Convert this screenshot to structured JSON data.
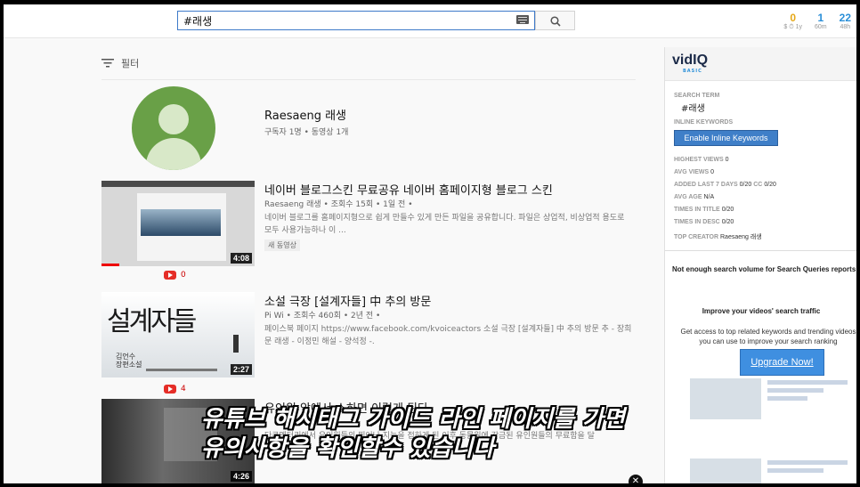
{
  "search": {
    "value": "#래생"
  },
  "stats": [
    {
      "value": "0",
      "label": "$ ⏱ 1y",
      "color": "#e6a817"
    },
    {
      "value": "1",
      "label": "60m",
      "color": "#2a8fd8"
    },
    {
      "value": "22",
      "label": "48h",
      "color": "#2a8fd8"
    }
  ],
  "filter": {
    "label": "필터"
  },
  "channel": {
    "name": "Raesaeng 래생",
    "meta": "구독자 1명 • 동영상 1개"
  },
  "videos": [
    {
      "title": "네이버 블로그스킨 무료공유 네이버 홈페이지형 블로그 스킨",
      "meta": "Raesaeng 래생 • 조회수 15회 • 1일 전 •",
      "desc": "네이버 블로그를 홈페이지형으로 쉽게 만들수 있게 만든 파일을 공유합니다. 파일은 상업적, 비상업적 용도로 모두 사용가능하나 이 ...",
      "badge": "새 동영상",
      "duration": "4:08",
      "yt_count": "0"
    },
    {
      "title": "소설 극장 [설계자들] 中 추의 방문",
      "meta": "Pi Wi • 조회수 460회 • 2년 전 •",
      "desc": "페이스북 페이지 https://www.facebook.com/kvoiceactors 소설 극장 [설계자들] 中 추의 방문 추 - 장희문 래생 - 이정민 해설 - 양석정 -.",
      "thumb_text": "설계자들",
      "thumb_sub": "김언수 장편소설",
      "duration": "2:27",
      "yt_count": "4"
    },
    {
      "title": "유인원 앞에서 쇼하면 이렇게 된다",
      "meta": "",
      "desc": "다큐멘터리에서 유인원들의 뛰어난 지능을 접하게 된 이후 동물원에 감금된 유인원들의 무료함을 달",
      "duration": "4:26"
    }
  ],
  "vidiq": {
    "logo": "vidIQ",
    "tier": "BASIC",
    "search_term_label": "SEARCH TERM",
    "search_term": "#래생",
    "inline_label": "INLINE KEYWORDS",
    "enable_button": "Enable Inline Keywords",
    "stats": [
      {
        "label": "HIGHEST VIEWS",
        "value": "0"
      },
      {
        "label": "AVG VIEWS",
        "value": "0"
      },
      {
        "label": "ADDED LAST 7 DAYS",
        "value": "0/20",
        "extra_label": "CC",
        "extra_value": "0/20"
      },
      {
        "label": "AVG AGE",
        "value": "N/A"
      },
      {
        "label": "TIMES IN TITLE",
        "value": "0/20"
      },
      {
        "label": "TIMES IN DESC",
        "value": "0/20"
      },
      {
        "label": "TOP CREATOR",
        "value": "Raesaeng 래생"
      }
    ],
    "not_enough": "Not enough search volume for Search Queries reports",
    "improve_title": "Improve your videos' search traffic",
    "improve_desc": "Get access to top related keywords and trending videos you can use to improve your search ranking",
    "upgrade": "Upgrade Now!"
  },
  "subtitle": {
    "line1": "유튜브 해시태그 가이드 라인 페이지를 가면",
    "line2": "유의사항을 확인할수 있습니다"
  }
}
